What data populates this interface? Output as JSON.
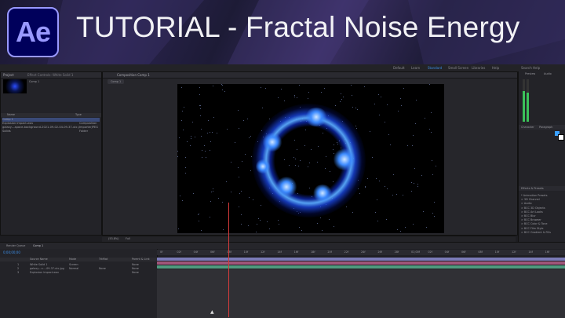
{
  "banner": {
    "logo_text": "Ae",
    "title": "TUTORIAL - Fractal Noise Energy",
    "accent_color": "#9999ff",
    "logo_bg": "#00005b"
  },
  "menubar": {
    "workspaces": [
      "Default",
      "Learn",
      "Standard",
      "Small Screen",
      "Libraries",
      "Help"
    ],
    "active_workspace": "Standard",
    "search_placeholder": "Search Help"
  },
  "project_panel": {
    "tab": "Project",
    "effect_tab": "Effect Controls: White Solid 1",
    "item_name": "Comp 1",
    "columns": [
      "Name",
      "Type"
    ],
    "items": [
      {
        "name": "Comp 1",
        "type": ""
      },
      {
        "name": "Explosion Impact.wav",
        "type": "Composition"
      },
      {
        "name": "galaxy---space-background-2021-09-02-04-09-37-utc.jpg",
        "type": "ImporterJPEG"
      },
      {
        "name": "Solids",
        "type": "Folder"
      }
    ]
  },
  "composition": {
    "tab": "Composition",
    "comp_name": "Comp 1",
    "sub_tab": "Comp 1",
    "footer_zoom": "(53.8%)",
    "footer_res": "Full"
  },
  "right_panel": {
    "preview_tab": "Preview",
    "audio_tab": "Audio",
    "character_tab": "Character",
    "paragraph_tab": "Paragraph",
    "effects_tab": "Effects & Presets",
    "effect_categories": [
      "* Animation Presets",
      "> 3D Channel",
      "> Audio",
      "> BCC 3D Objects",
      "> BCC Art Looks",
      "> BCC Blur",
      "> BCC Browser",
      "> BCC Color & Tone",
      "> BCC Film Style",
      "> BCC Gradient & Fills"
    ],
    "meter_levels": [
      0.72,
      0.68
    ]
  },
  "timeline": {
    "tabs": [
      "Render Queue",
      "Comp 1"
    ],
    "timecode": "0;00;00;00",
    "columns": [
      "Source Name",
      "Mode",
      "TrkMat",
      "Parent & Link"
    ],
    "layers": [
      {
        "num": "1",
        "name": "White Solid 1",
        "mode": "Screen",
        "trkmat": "",
        "parent": "None"
      },
      {
        "num": "2",
        "name": "galaxy---s...-09-37-utc.jpg",
        "mode": "Normal",
        "trkmat": "None",
        "parent": "None"
      },
      {
        "num": "3",
        "name": "Explosion Impact.wav",
        "mode": "",
        "trkmat": "",
        "parent": "None"
      }
    ],
    "ruler_ticks": [
      "0f",
      "02f",
      "04f",
      "06f",
      "08f",
      "10f",
      "12f",
      "14f",
      "16f",
      "18f",
      "20f",
      "22f",
      "24f",
      "26f",
      "28f",
      "01;00f",
      "02f",
      "04f",
      "06f",
      "08f",
      "10f",
      "12f",
      "14f",
      "16f"
    ],
    "track_colors": [
      "#7b7bb8",
      "#a0567a",
      "#4f9a7f"
    ]
  }
}
